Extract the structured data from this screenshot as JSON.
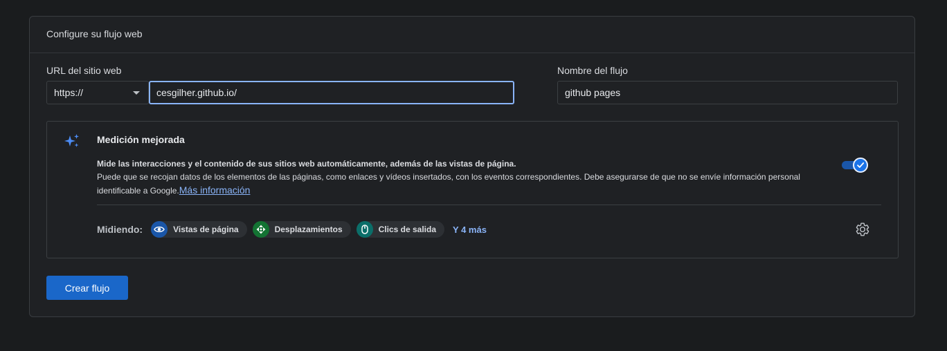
{
  "card": {
    "title": "Configure su flujo web"
  },
  "url_field": {
    "label": "URL del sitio web",
    "protocol": "https://",
    "value": "cesgilher.github.io/"
  },
  "name_field": {
    "label": "Nombre del flujo",
    "value": "github pages"
  },
  "enhanced_measurement": {
    "title": "Medición mejorada",
    "description_line1": "Mide las interacciones y el contenido de sus sitios web automáticamente, además de las vistas de página.",
    "description_line2": "Puede que se recojan datos de los elementos de las páginas, como enlaces y vídeos insertados, con los eventos correspondientes. Debe asegurarse de que no se envíe información personal identificable a Google.",
    "more_info_link": "Más información",
    "toggle_on": true,
    "measuring_label": "Midiendo:",
    "chips": [
      {
        "label": "Vistas de página",
        "icon": "eye-icon",
        "color": "#1a56a8"
      },
      {
        "label": "Desplazamientos",
        "icon": "scroll-arrows-icon",
        "color": "#137333"
      },
      {
        "label": "Clics de salida",
        "icon": "mouse-icon",
        "color": "#0b6e69"
      }
    ],
    "more_chips_link": "Y 4 más"
  },
  "actions": {
    "create_label": "Crear flujo"
  },
  "colors": {
    "accent": "#8ab4f8",
    "primary_button": "#1a67c9"
  }
}
